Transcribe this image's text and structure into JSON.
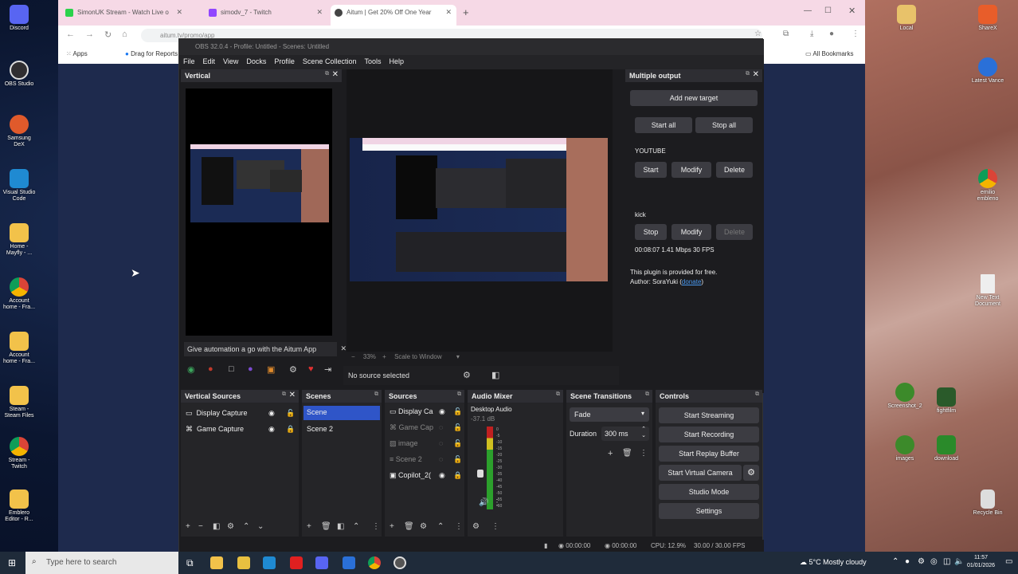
{
  "desktop": {
    "left_icons": [
      {
        "label": "Discord",
        "color": "#5865f2"
      },
      {
        "label": "OBS Studio",
        "color": "#302e31"
      },
      {
        "label": "Samsung DeX",
        "color": "#e05a2b"
      },
      {
        "label": "Visual Studio Code",
        "color": "#1f8ad2"
      },
      {
        "label": "Home - Mayfly - ...",
        "color": "#f2c24a"
      },
      {
        "label": "Account home - Fra...",
        "color": "#dddddd"
      },
      {
        "label": "Account home - Fra...",
        "color": "#f2c24a"
      },
      {
        "label": "Steam - Steam Files",
        "color": "#f2c24a"
      },
      {
        "label": "Stream - Twitch",
        "color": "#dddddd"
      },
      {
        "label": "Emblero Editor - R...",
        "color": "#f2c24a"
      }
    ],
    "right_icons": [
      {
        "label": "Local",
        "color": "#e8c26a"
      },
      {
        "label": "ShareX",
        "color": "#e85d2a"
      },
      {
        "label": "Latest Vance",
        "color": "#2a70d8"
      },
      {
        "label": "emilio embleno",
        "color": "#ffffff"
      },
      {
        "label": "New Text Document",
        "color": "#eeeeee"
      },
      {
        "label": "Screenshot_2",
        "color": "#3c8a2a"
      },
      {
        "label": "fightfilm",
        "color": "#2a5a2a"
      },
      {
        "label": "images",
        "color": "#3c8a2a"
      },
      {
        "label": "download",
        "color": "#2a8a2a"
      },
      {
        "label": "Recycle Bin",
        "color": "#dddddd"
      }
    ]
  },
  "browser": {
    "tabs": [
      {
        "label": "SimonUK Stream - Watch Live o",
        "color": "#2bd24b"
      },
      {
        "label": "simodv_7 - Twitch",
        "color": "#9146ff"
      },
      {
        "label": "Aitum | Get 20% Off One Year",
        "color": "#444444"
      }
    ],
    "url": "aitum.tv/promo/app",
    "bookmarks": [
      {
        "label": "Apps"
      },
      {
        "label": "Drag for Reports"
      }
    ],
    "all_bookmarks": "All Bookmarks"
  },
  "obs": {
    "window_title": "OBS 32.0.4 - Profile: Untitled - Scenes: Untitled",
    "menu": [
      "File",
      "Edit",
      "View",
      "Docks",
      "Profile",
      "Scene Collection",
      "Tools",
      "Help"
    ],
    "vertical": {
      "title": "Vertical",
      "promo": "Give automation a go with the Aitum App"
    },
    "preview": {
      "zoom": "33%",
      "scale_label": "Scale to Window",
      "no_source": "No source selected"
    },
    "multiple_output": {
      "title": "Multiple output",
      "add_target": "Add new target",
      "start_all": "Start all",
      "stop_all": "Stop all",
      "targets": [
        {
          "name": "YOUTUBE",
          "primary": "Start",
          "modify": "Modify",
          "delete": "Delete"
        },
        {
          "name": "kick",
          "primary": "Stop",
          "modify": "Modify",
          "delete": "Delete",
          "stats": "00:08:07  1.41 Mbps  30 FPS"
        }
      ],
      "footer_line1": "This plugin is provided for free.",
      "footer_line2": "Author: SoraYuki (",
      "donate": "donate",
      "footer_close": ")"
    },
    "vertical_sources": {
      "title": "Vertical Sources",
      "items": [
        "Display Capture",
        "Game Capture"
      ]
    },
    "scenes": {
      "title": "Scenes",
      "items": [
        "Scene",
        "Scene 2"
      ]
    },
    "sources": {
      "title": "Sources",
      "items": [
        "Display Ca",
        "Game Cap",
        "image",
        "Scene 2",
        "Copilot_2("
      ]
    },
    "audio_mixer": {
      "title": "Audio Mixer",
      "channel": "Desktop Audio",
      "level": "-37.1 dB",
      "scale": [
        "0",
        "-5",
        "-10",
        "-15",
        "-20",
        "-25",
        "-30",
        "-35",
        "-40",
        "-45",
        "-50",
        "-55",
        "-60"
      ]
    },
    "transitions": {
      "title": "Scene Transitions",
      "type": "Fade",
      "duration_label": "Duration",
      "duration": "300 ms"
    },
    "controls": {
      "title": "Controls",
      "buttons": [
        "Start Streaming",
        "Start Recording",
        "Start Replay Buffer",
        "Start Virtual Camera",
        "Studio Mode",
        "Settings"
      ]
    },
    "status": {
      "stream_time": "00:00:00",
      "rec_time": "00:00:00",
      "cpu": "CPU: 12.9%",
      "fps": "30.00 / 30.00 FPS"
    }
  },
  "taskbar": {
    "search_placeholder": "Type here to search",
    "weather": "5°C  Mostly cloudy",
    "time": "11:57",
    "date": "01/01/2026"
  }
}
